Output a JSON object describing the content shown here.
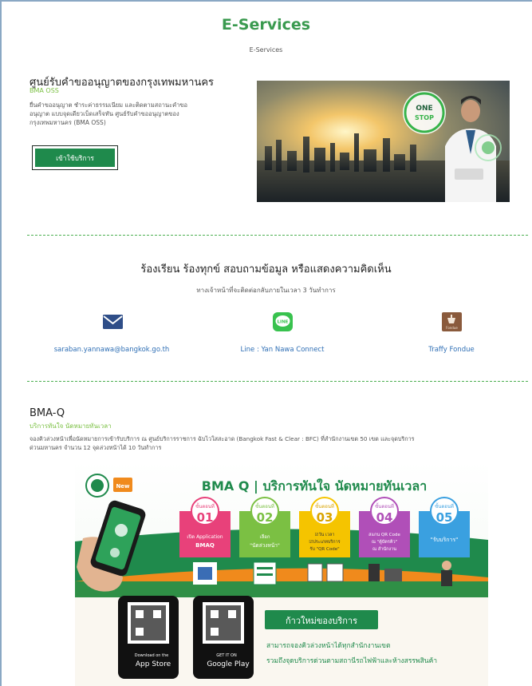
{
  "page": {
    "title": "E-Services",
    "breadcrumb": "E-Services"
  },
  "oss": {
    "title": "ศูนย์รับคำขออนุญาตของกรุงเทพมหานคร",
    "subtitle": "BMA OSS",
    "description_lines": [
      "ยื่นคำขออนุญาต ชำระค่าธรรมเนียม และติดตามสถานะคำขอ",
      "อนุญาต แบบจุดเดียวเบ็ดเสร็จทัน ศูนย์รับคำขออนุญาตของ",
      "กรุงเทพมหานคร (BMA OSS)"
    ],
    "button_label": "เข้าใช้บริการ"
  },
  "contact": {
    "title": "ร้องเรียน ร้องทุกข์ สอบถามข้อมูล หรือแสดงความคิดเห็น",
    "subtitle": "ทางเจ้าหน้าที่จะติดต่อกลับภายในเวลา 3 วันทำการ",
    "items": [
      {
        "label": "saraban.yannawa@bangkok.go.th",
        "icon": "mail-icon"
      },
      {
        "label": "Line : Yan Nawa Connect",
        "icon": "line-icon"
      },
      {
        "label": "Traffy Fondue",
        "icon": "traffy-fondue-icon"
      }
    ]
  },
  "bmaq": {
    "title": "BMA-Q",
    "subtitle": "บริการทันใจ นัดหมายทันเวลา",
    "description_lines": [
      "จองคิวล่วงหน้าเพื่อนัดหมายการเข้ารับบริการ ณ ศูนย์บริการราชการ ฉับไวใสสะอาด (Bangkok Fast & Clear : BFC) ที่สำนักงานเขต 50 เขต และจุดบริการ",
      "ด่วนมหานคร จำนวน 12 จุดล่วงหน้าได้ 10 วันทำการ"
    ],
    "banner": {
      "heading": "BMA Q | บริการทันใจ นัดหมายทันเวลา",
      "brand_badge": "New",
      "steps": [
        {
          "step_label": "ขั้นตอนที่",
          "number": "01",
          "text": "เปิด Application\nBMAQ"
        },
        {
          "step_label": "ขั้นตอนที่",
          "number": "02",
          "text": "เลือก\n\"นัดล่วงหน้า\""
        },
        {
          "step_label": "ขั้นตอนที่",
          "number": "03",
          "text": "☑วัน เวลา\n☑ประเภทบริการ\nรับ \"QR Code\""
        },
        {
          "step_label": "ขั้นตอนที่",
          "number": "04",
          "text": "สแกน QR Code\nณ \"ตู้บัตรคิว\"\nณ สำนักงาน"
        },
        {
          "step_label": "ขั้นตอนที่",
          "number": "05",
          "text": "\"รับบริการ\""
        }
      ],
      "app_store": {
        "top": "Download on the",
        "name": "App Store"
      },
      "google_play": {
        "top": "GET IT ON",
        "name": "Google Play"
      },
      "new_title": "ก้าวใหม่ของบริการ",
      "new_lines": [
        "สามารถจองคิวล่วงหน้าได้ทุกสำนักงานเขต",
        "รวมถึงจุดบริการด่วนตามสถานีรถไฟฟ้าและห้างสรรพสินค้า"
      ]
    }
  },
  "colors": {
    "brand_green": "#3a9a4f",
    "button_green": "#1f8a4c",
    "link_blue": "#2f6fb5",
    "accent_lime": "#7bc043"
  }
}
